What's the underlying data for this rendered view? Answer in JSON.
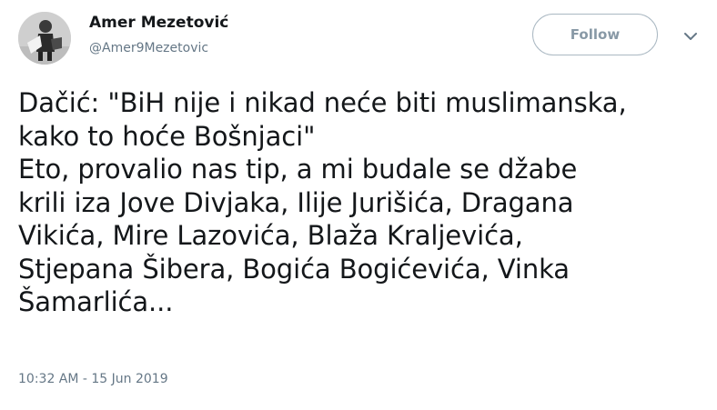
{
  "author": {
    "name": "Amer Mezetović",
    "handle": "@Amer9Mezetovic",
    "avatar": "avatar-photo"
  },
  "actions": {
    "follow_label": "Follow",
    "menu_icon": "chevron-down-icon"
  },
  "tweet": {
    "lines": [
      "Dačić: \"BiH nije i nikad neće biti muslimanska,",
      "kako to hoće Bošnjaci\"",
      "Eto, provalio nas tip, a mi budale se džabe",
      "krili iza Jove Divjaka, Ilije Jurišića, Dragana",
      "Vikića, Mire Lazovića, Blaža Kraljevića,",
      "Stjepana Šibera, Bogića Bogićevića, Vinka",
      "Šamarlića..."
    ],
    "timestamp": "10:32 AM - 15 Jun 2019"
  },
  "colors": {
    "text": "#14171a",
    "secondary": "#657786",
    "button_border": "#aab8c2"
  }
}
